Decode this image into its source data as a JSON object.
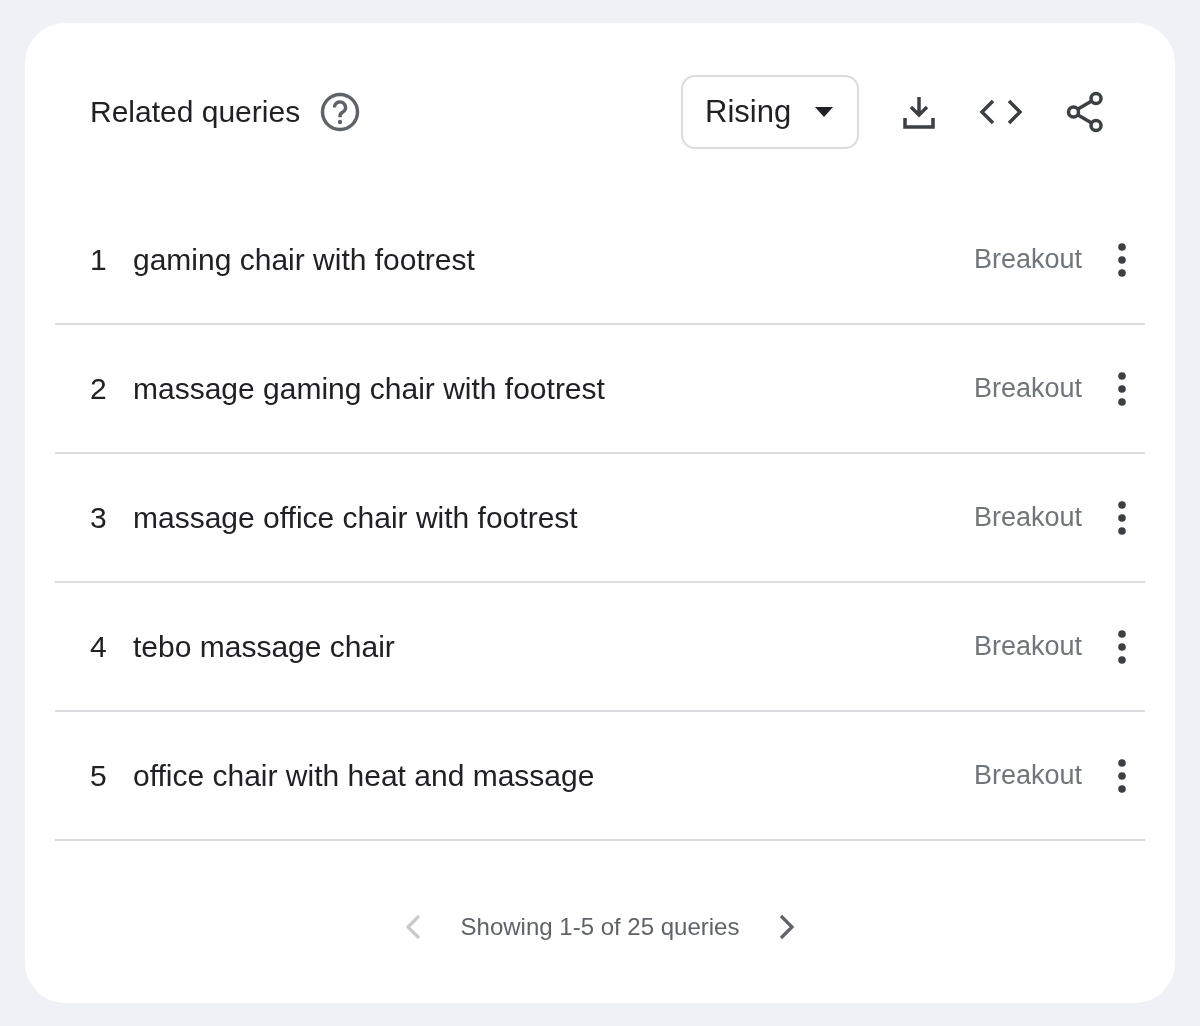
{
  "title": "Related queries",
  "dropdown": {
    "value": "Rising"
  },
  "rows": [
    {
      "rank": "1",
      "query": "gaming chair with footrest",
      "value": "Breakout"
    },
    {
      "rank": "2",
      "query": "massage gaming chair with footrest",
      "value": "Breakout"
    },
    {
      "rank": "3",
      "query": "massage office chair with footrest",
      "value": "Breakout"
    },
    {
      "rank": "4",
      "query": "tebo massage chair",
      "value": "Breakout"
    },
    {
      "rank": "5",
      "query": "office chair with heat and massage",
      "value": "Breakout"
    }
  ],
  "pagination": {
    "text": "Showing 1-5 of 25 queries",
    "prev_disabled": true,
    "next_disabled": false
  }
}
